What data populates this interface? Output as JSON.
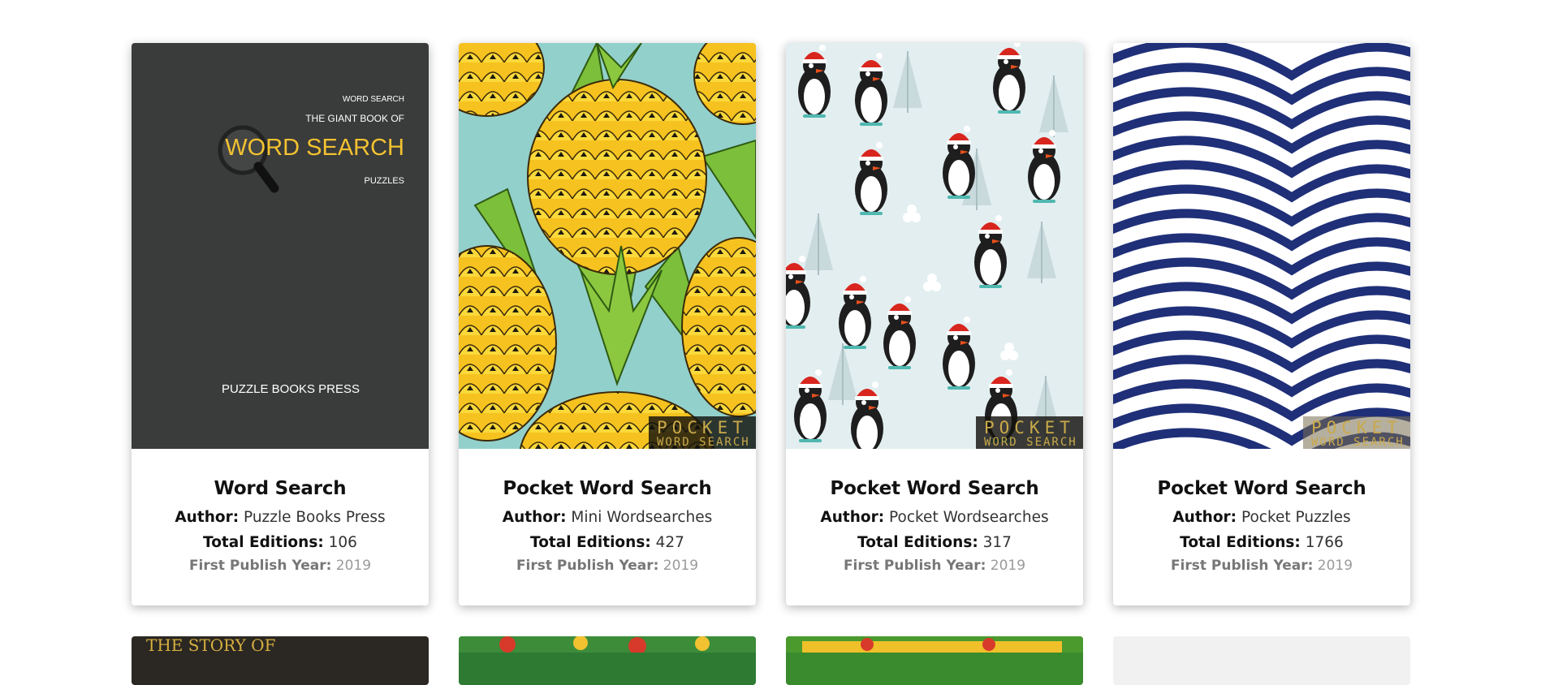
{
  "cards": [
    {
      "title": "Word Search",
      "author_label": "Author:",
      "author": "Puzzle Books Press",
      "editions_label": "Total Editions:",
      "editions": "106",
      "year_label": "First Publish Year:",
      "year": "2019",
      "cover_text": {
        "line1": "WORD SEARCH",
        "line2": "THE GIANT BOOK OF",
        "line3": "WORD SEARCH",
        "line4": "PUZZLES",
        "publisher": "PUZZLE BOOKS PRESS"
      }
    },
    {
      "title": "Pocket Word Search",
      "author_label": "Author:",
      "author": "Mini Wordsearches",
      "editions_label": "Total Editions:",
      "editions": "427",
      "year_label": "First Publish Year:",
      "year": "2019",
      "badge_top": "POCKET",
      "badge_bottom": "WORD SEARCH"
    },
    {
      "title": "Pocket Word Search",
      "author_label": "Author:",
      "author": "Pocket Wordsearches",
      "editions_label": "Total Editions:",
      "editions": "317",
      "year_label": "First Publish Year:",
      "year": "2019",
      "badge_top": "POCKET",
      "badge_bottom": "WORD SEARCH"
    },
    {
      "title": "Pocket Word Search",
      "author_label": "Author:",
      "author": "Pocket Puzzles",
      "editions_label": "Total Editions:",
      "editions": "1766",
      "year_label": "First Publish Year:",
      "year": "2019",
      "badge_top": "POCKET",
      "badge_bottom": "WORD SEARCH"
    }
  ],
  "next_row": {
    "first_cover_text": "THE STORY OF"
  },
  "colors": {
    "cover1_bg": "#3a3b3b",
    "cover1_accent": "#f2c230",
    "pineapple_bg": "#92d0cc",
    "penguin_bg": "#e3eef0",
    "wave_blue": "#1f2f78"
  }
}
